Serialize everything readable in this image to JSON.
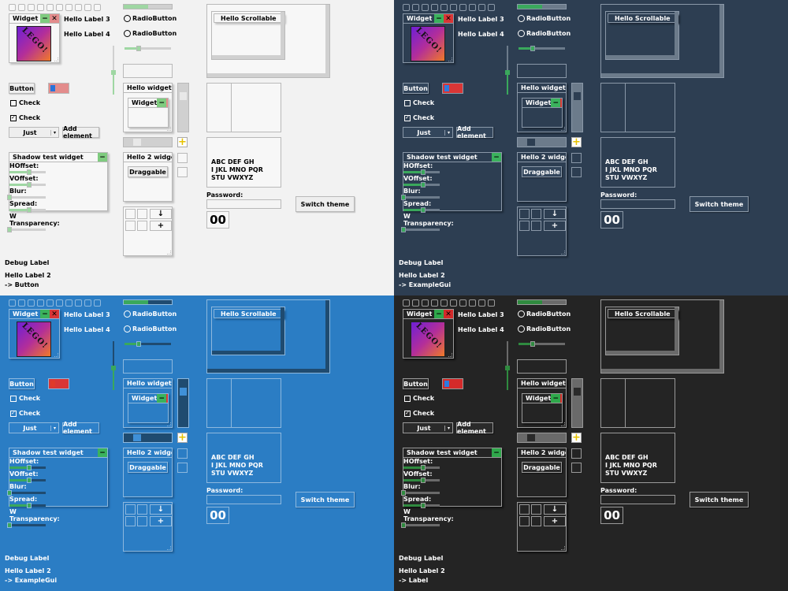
{
  "quadrants": [
    {
      "theme": "light",
      "bg": "#f2f2f2",
      "fg": "#000000",
      "panel": "#f7f7f7",
      "frame": "#b9b9b9",
      "frame2": "#c8c8c8",
      "shadow": "#c0c0c0",
      "btn": "#eeeeee",
      "field": "#f4f4f4",
      "track": "#d0d0d0",
      "accent": "#9fd7a3",
      "accent2": "#2a73d9",
      "knob2": "#e8e8e8",
      "green": "#7fcb7f",
      "red": "#e38c8c",
      "status": "-> Button"
    },
    {
      "theme": "dark-slate",
      "bg": "#2d3e52",
      "fg": "#ffffff",
      "panel": "#2d3e52",
      "frame": "#8a98a8",
      "frame2": "#a8b4c0",
      "shadow": "#1c2836",
      "btn": "#33465c",
      "field": "#2d3e52",
      "track": "#6c7b8b",
      "accent": "#3aa85c",
      "accent2": "#2d7be0",
      "knob2": "#2d3e52",
      "green": "#3bb25d",
      "red": "#d93636",
      "status": "-> ExampleGui"
    },
    {
      "theme": "blue",
      "bg": "#2b7dc4",
      "fg": "#ffffff",
      "panel": "#2b7dc4",
      "frame": "#8db8de",
      "frame2": "#a6c8e6",
      "shadow": "#1d5d96",
      "btn": "#2e80c8",
      "field": "#2b7dc4",
      "track": "#1f4b70",
      "accent": "#3aa85c",
      "accent2": "#e03a2a",
      "knob2": "#3f90d8",
      "green": "#3bb25d",
      "red": "#d93636",
      "status": "-> ExampleGui"
    },
    {
      "theme": "dark",
      "bg": "#242424",
      "fg": "#ffffff",
      "panel": "#242424",
      "frame": "#9a9a9a",
      "frame2": "#b3b3b3",
      "shadow": "#111111",
      "btn": "#2a2a2a",
      "field": "#242424",
      "track": "#6a6a6a",
      "accent": "#2f8a3f",
      "accent2": "#2d7be0",
      "knob2": "#2a2a2a",
      "green": "#2fa84b",
      "red": "#d42a2a",
      "status": "-> Label"
    }
  ],
  "widget_title": "Widget",
  "lego_text": "LEGO!",
  "label3": "Hello Label 3",
  "label4": "Hello Label 4",
  "radio1": "RadioButton",
  "radio2": "RadioButton",
  "button": "Button",
  "check1": "Check",
  "check2": "Check",
  "check2_mark": "✓",
  "dropdown_value": "Just",
  "add_element": "Add element",
  "hello_widget": "Hello widget",
  "inner_widget": "Widget",
  "hello2": "Hello 2 widget",
  "draggable": "Draggable",
  "scrollable": "Hello Scrollable",
  "shadow_title": "Shadow test widget",
  "shadow_rows": [
    {
      "label": "HOffset:",
      "value": 0.55
    },
    {
      "label": "VOffset:",
      "value": 0.55
    },
    {
      "label": "Blur:",
      "value": 0.0
    },
    {
      "label": "Spread:",
      "value": 0.55
    },
    {
      "label": "W Transparency:",
      "value": 0.0
    }
  ],
  "textbox_lines": [
    "ABC DEF GH",
    "I JKL MNO PQR",
    "STU VWXYZ"
  ],
  "password_label": "Password:",
  "switch_theme": "Switch theme",
  "counter": "00",
  "debug_label": "Debug Label",
  "hello_label2": "Hello Label 2",
  "minus_glyph": "−",
  "close_glyph": "✕",
  "arrow_glyph": "↓",
  "plus_glyph": "+",
  "progress": 0.5,
  "slider_value": 0.3,
  "vslider_value": 0.45
}
